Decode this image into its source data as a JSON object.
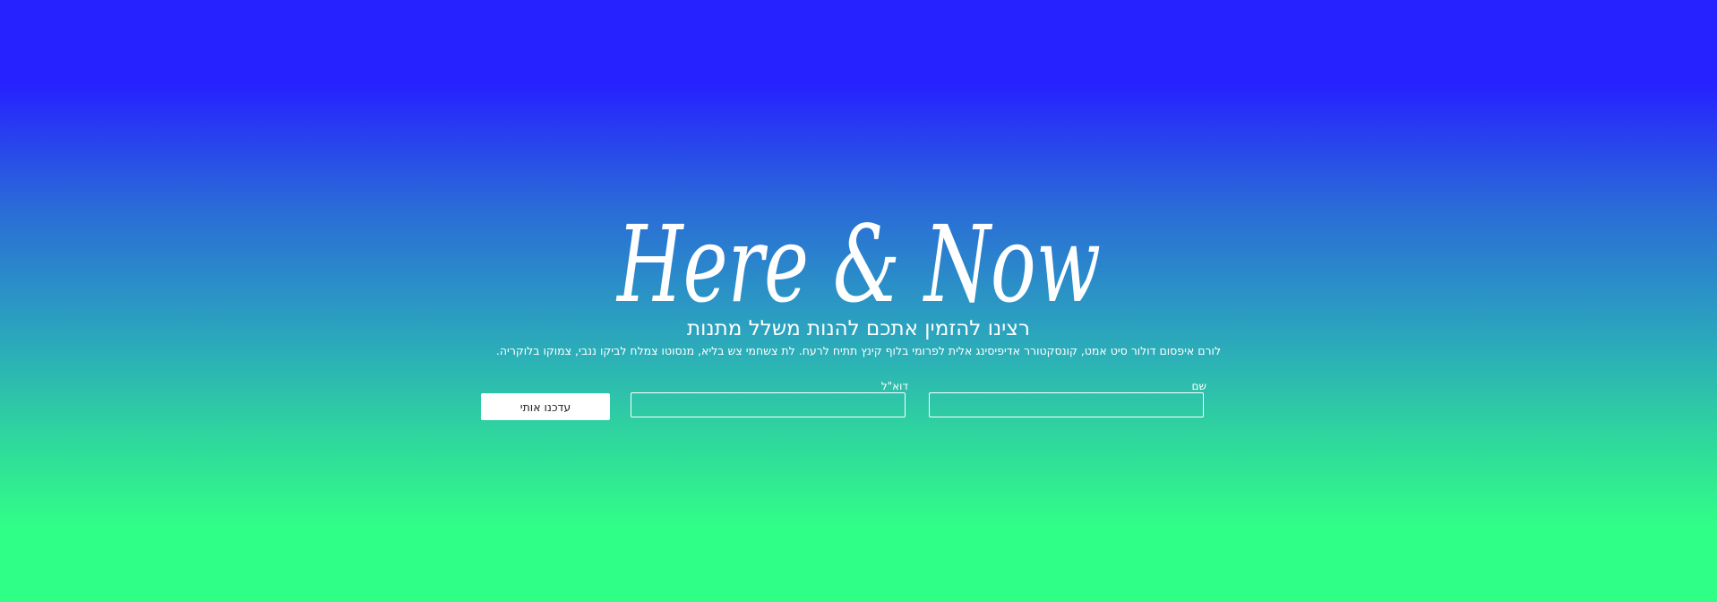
{
  "hero": {
    "logo_text": "Here & Now",
    "headline": "רצינו להזמין אתכם להנות משלל מתנות",
    "subtext": "לורם איפסום דולור סיט אמט, קונסקטורר אדיפיסינג אלית לפרומי בלוף קינץ תתיח לרעח. לת צשחמי צש בליא, מנסוטו צמלח לביקו ננבי, צמוקו בלוקריה."
  },
  "form": {
    "name_label": "שם",
    "name_value": "",
    "email_label": "דוא\"ל",
    "email_value": "",
    "submit_label": "עדכנו אותי"
  },
  "colors": {
    "gradient_top": "#2622ff",
    "gradient_bottom": "#30ff87",
    "text": "#ffffff",
    "button_bg": "#ffffff",
    "button_text": "#222222"
  }
}
